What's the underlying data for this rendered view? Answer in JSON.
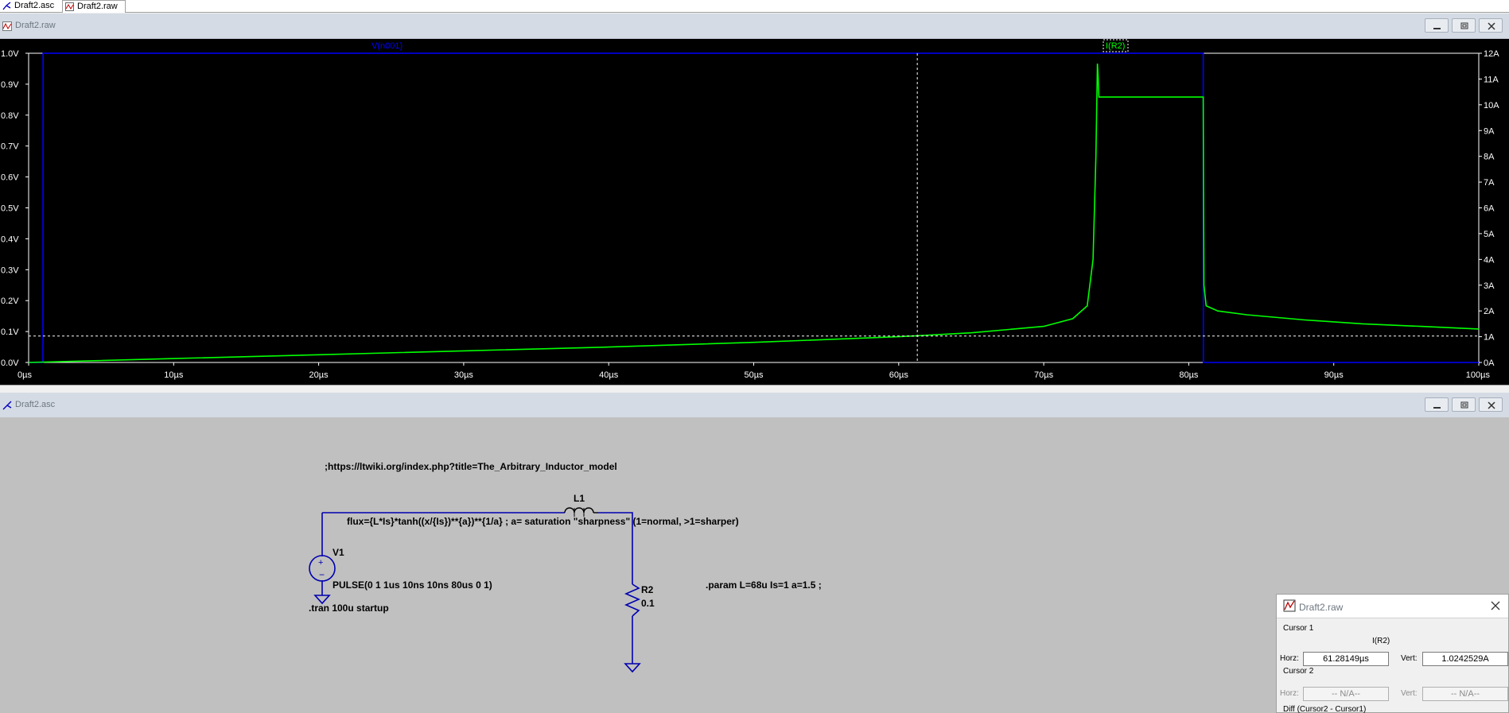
{
  "tabs": [
    {
      "label": "Draft2.asc"
    },
    {
      "label": "Draft2.raw"
    }
  ],
  "waveform_window": {
    "title": "Draft2.raw"
  },
  "schematic_window": {
    "title": "Draft2.asc"
  },
  "chart_data": {
    "type": "line",
    "x_unit": "µs",
    "xlim": [
      0,
      100
    ],
    "x_ticks": [
      "0µs",
      "10µs",
      "20µs",
      "30µs",
      "40µs",
      "50µs",
      "60µs",
      "70µs",
      "80µs",
      "90µs",
      "100µs"
    ],
    "y_left_lim": [
      0,
      1.0
    ],
    "y_left_ticks": [
      "0.0V",
      "0.1V",
      "0.2V",
      "0.3V",
      "0.4V",
      "0.5V",
      "0.6V",
      "0.7V",
      "0.8V",
      "0.9V",
      "1.0V"
    ],
    "y_right_lim": [
      0,
      12
    ],
    "y_right_ticks": [
      "0A",
      "1A",
      "2A",
      "3A",
      "4A",
      "5A",
      "6A",
      "7A",
      "8A",
      "9A",
      "10A",
      "11A",
      "12A"
    ],
    "grid": false,
    "series": [
      {
        "name": "V(n001)",
        "axis": "left",
        "color": "#0000ff",
        "x": [
          0,
          0.99,
          1.0,
          81.0,
          81.01,
          100
        ],
        "y": [
          0,
          0,
          1.0,
          1.0,
          0,
          0
        ]
      },
      {
        "name": "I(R2)",
        "axis": "right",
        "color": "#00ff00",
        "x": [
          0,
          10,
          20,
          30,
          40,
          50,
          60,
          65,
          70,
          72,
          73,
          73.4,
          73.6,
          73.7,
          73.75,
          73.8,
          74,
          81.0,
          81.05,
          81.2,
          82,
          84,
          88,
          92,
          96,
          100
        ],
        "y": [
          0,
          0.15,
          0.3,
          0.45,
          0.6,
          0.78,
          1.0,
          1.15,
          1.4,
          1.7,
          2.2,
          4,
          8,
          11.6,
          11.1,
          10.3,
          10.3,
          10.3,
          3.0,
          2.2,
          2.0,
          1.85,
          1.65,
          1.5,
          1.4,
          1.3
        ]
      }
    ],
    "cursor": {
      "x": 61.28149,
      "y_right": 1.0242529
    }
  },
  "schematic": {
    "comment": ";https://ltwiki.org/index.php?title=The_Arbitrary_Inductor_model",
    "flux": "flux={L*Is}*tanh((x/{Is})**{a})**{1/a} ; a= saturation \"sharpness\" (1=normal, >1=sharper)",
    "l1": "L1",
    "v1": "V1",
    "pulse": "PULSE(0 1 1us 10ns 10ns 80us 0 1)",
    "tran": ".tran 100u startup",
    "r2": "R2",
    "r2_value": "0.1",
    "param": ".param L=68u Is=1 a=1.5 ;"
  },
  "cursor_window": {
    "title": "Draft2.raw",
    "cursor1_label": "Cursor 1",
    "trace_name": "I(R2)",
    "horz_label": "Horz:",
    "horz_value": "61.28149µs",
    "vert_label": "Vert:",
    "vert_value": "1.0242529A",
    "cursor2_label": "Cursor 2",
    "horz2_value": "-- N/A--",
    "vert2_value": "-- N/A--",
    "diff_label": "Diff (Cursor2 - Cursor1)"
  }
}
